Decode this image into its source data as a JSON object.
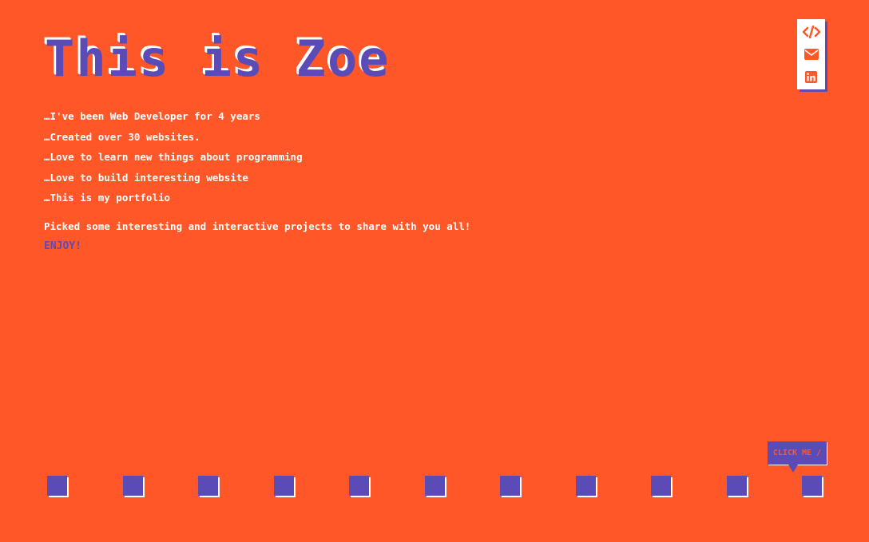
{
  "header": {
    "title": "This is Zoe"
  },
  "bio": {
    "lines": [
      "…I've been Web Developer for 4 years",
      "…Created over 30 websites.",
      "…Love to learn new things about programming",
      "…Love to build interesting website",
      "…This is my portfolio"
    ]
  },
  "intro": {
    "text": "Picked some interesting and interactive projects to share with you all!",
    "enjoy": "ENJOY!"
  },
  "social": {
    "icons": [
      "code-icon",
      "envelope-icon",
      "linkedin-icon"
    ]
  },
  "tooltip": {
    "label": "CLICK ME /"
  },
  "projects": {
    "count": 11
  },
  "colors": {
    "background": "#ff5728",
    "accent": "#5b4bb6",
    "text": "#ffffff"
  }
}
